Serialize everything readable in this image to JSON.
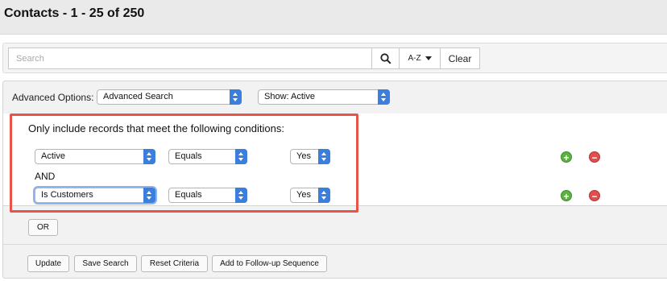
{
  "header": {
    "title": "Contacts - 1 - 25 of 250"
  },
  "search": {
    "placeholder": "Search",
    "sort_label": "A-Z",
    "clear_label": "Clear"
  },
  "advanced": {
    "label": "Advanced Options:",
    "mode_select": "Advanced Search",
    "show_select": "Show: Active"
  },
  "criteria": {
    "title": "Only include records that meet the following conditions:",
    "join_label": "AND",
    "rows": [
      {
        "field": "Active",
        "operator": "Equals",
        "value": "Yes"
      },
      {
        "field": "Is Customers",
        "operator": "Equals",
        "value": "Yes"
      }
    ],
    "or_label": "OR"
  },
  "footer": {
    "buttons": [
      "Update",
      "Save Search",
      "Reset Criteria",
      "Add to Follow-up Sequence"
    ]
  },
  "icons": {
    "search": "magnifier-icon",
    "add": "plus-circle-icon",
    "remove": "minus-circle-icon"
  },
  "colors": {
    "highlight": "#e85448",
    "select_accent": "#3a7fde",
    "add": "#5bb141",
    "remove": "#e04e4e"
  }
}
